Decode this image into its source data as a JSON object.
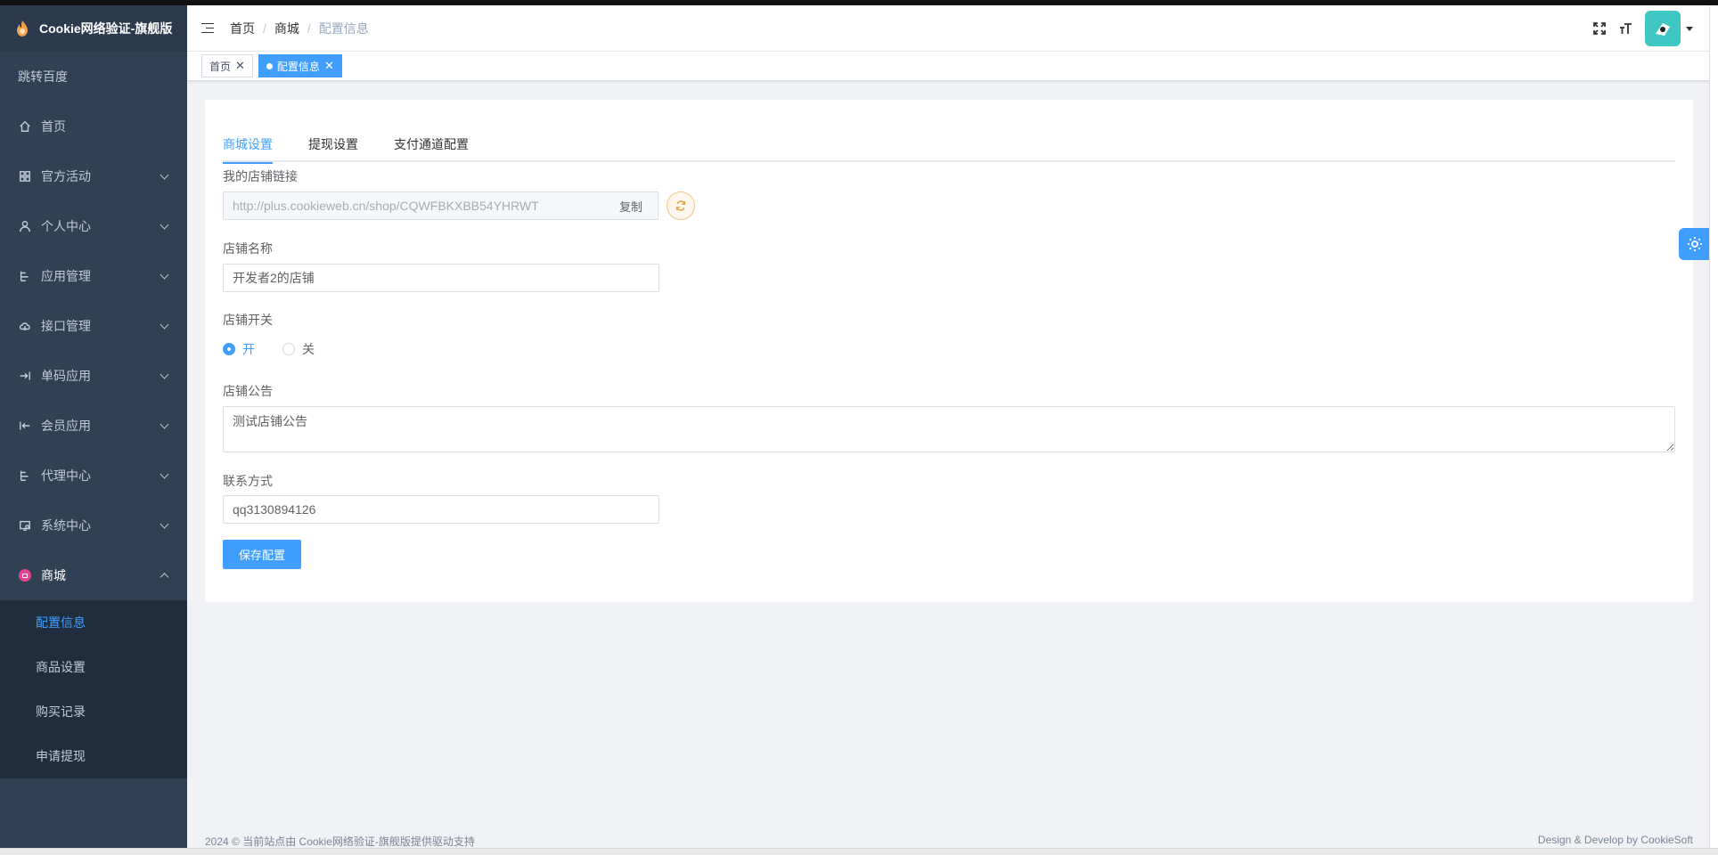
{
  "sidebar": {
    "logo_text": "Cookie网络验证-旗舰版",
    "top_link": "跳转百度",
    "items": [
      {
        "label": "首页"
      },
      {
        "label": "官方活动"
      },
      {
        "label": "个人中心"
      },
      {
        "label": "应用管理"
      },
      {
        "label": "接口管理"
      },
      {
        "label": "单码应用"
      },
      {
        "label": "会员应用"
      },
      {
        "label": "代理中心"
      },
      {
        "label": "系统中心"
      },
      {
        "label": "商城"
      }
    ],
    "submenu": [
      {
        "label": "配置信息"
      },
      {
        "label": "商品设置"
      },
      {
        "label": "购买记录"
      },
      {
        "label": "申请提现"
      }
    ]
  },
  "header": {
    "breadcrumb": [
      "首页",
      "商城",
      "配置信息"
    ]
  },
  "tags": [
    {
      "label": "首页",
      "close": "✕"
    },
    {
      "label": "配置信息",
      "close": "✕"
    }
  ],
  "tabs": [
    "商城设置",
    "提现设置",
    "支付通道配置"
  ],
  "form": {
    "shop_link_label": "我的店铺链接",
    "shop_link_value": "http://plus.cookieweb.cn/shop/CQWFBKXBB54YHRWT",
    "copy_label": "复制",
    "shop_name_label": "店铺名称",
    "shop_name_value": "开发者2的店铺",
    "shop_switch_label": "店铺开关",
    "switch_on": "开",
    "switch_off": "关",
    "switch_value": "开",
    "notice_label": "店铺公告",
    "notice_value": "测试店铺公告",
    "contact_label": "联系方式",
    "contact_value": "qq3130894126",
    "save_label": "保存配置"
  },
  "footer": {
    "left": "2024 © 当前站点由 Cookie网络验证-旗舰版提供驱动支持",
    "right": "Design & Develop by CookieSoft"
  },
  "colors": {
    "sidebar_bg": "#304156",
    "submenu_bg": "#1f2d3d",
    "primary": "#409eff",
    "avatar_bg": "#3fc7c4"
  }
}
